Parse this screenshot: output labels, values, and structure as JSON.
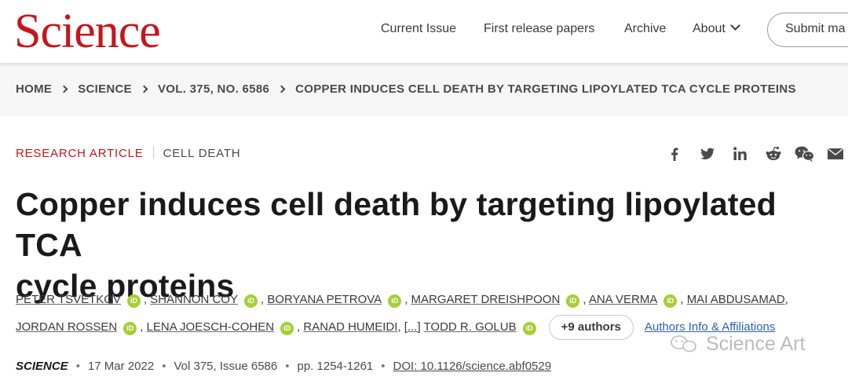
{
  "header": {
    "logo": "Science",
    "nav": [
      "Current Issue",
      "First release papers",
      "Archive",
      "About"
    ],
    "submit_label": "Submit ma"
  },
  "breadcrumb": [
    "HOME",
    "SCIENCE",
    "VOL. 375, NO. 6586",
    "COPPER INDUCES CELL DEATH BY TARGETING LIPOYLATED TCA CYCLE PROTEINS"
  ],
  "article": {
    "type": "RESEARCH ARTICLE",
    "subject": "CELL DEATH",
    "title_line1": "Copper induces cell death by targeting lipoylated TCA",
    "title_line2": "cycle proteins",
    "authors": [
      "PETER TSVETKOV",
      "SHANNON COY",
      "BORYANA PETROVA",
      "MARGARET DREISHPOON",
      "ANA VERMA",
      "MAI ABDUSAMAD",
      "JORDAN ROSSEN",
      "LENA JOESCH-COHEN",
      "RANAD HUMEIDI"
    ],
    "ellipsis": "[...]",
    "last_author": "TODD R. GOLUB",
    "orcid_label": "iD",
    "more_authors": "+9 authors",
    "affiliations_link": "Authors Info & Affiliations",
    "journal": "SCIENCE",
    "date": "17 Mar 2022",
    "volume": "Vol 375, Issue 6586",
    "pages": "pp. 1254-1261",
    "doi": "DOI: 10.1126/science.abf0529"
  },
  "share_icons": [
    "facebook-icon",
    "twitter-icon",
    "linkedin-icon",
    "reddit-icon",
    "wechat-icon",
    "email-icon"
  ],
  "watermark": "Science Art",
  "colors": {
    "brand": "#c4161c",
    "orcid": "#a6ce39",
    "link": "#2c5fb5"
  }
}
